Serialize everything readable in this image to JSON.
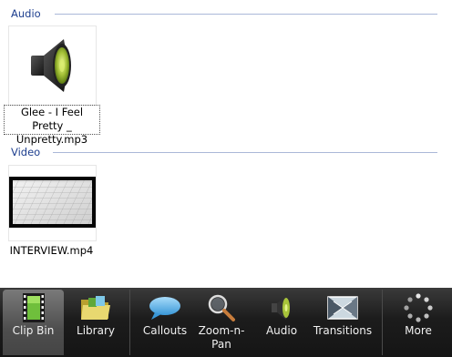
{
  "sections": {
    "audio": {
      "label": "Audio",
      "clip_name": "Glee - I Feel Pretty _ Unpretty.mp3"
    },
    "video": {
      "label": "Video",
      "clip_name": "INTERVIEW.mp4"
    }
  },
  "toolbar": {
    "items": [
      {
        "label": "Clip Bin",
        "icon": "film-strip-icon",
        "active": true
      },
      {
        "label": "Library",
        "icon": "folder-icon"
      },
      {
        "label": "Callouts",
        "icon": "speech-bubble-icon"
      },
      {
        "label": "Zoom-n-Pan",
        "icon": "magnifier-icon"
      },
      {
        "label": "Audio",
        "icon": "speaker-icon"
      },
      {
        "label": "Transitions",
        "icon": "transitions-icon"
      },
      {
        "label": "More",
        "icon": "more-dots-icon"
      }
    ]
  }
}
